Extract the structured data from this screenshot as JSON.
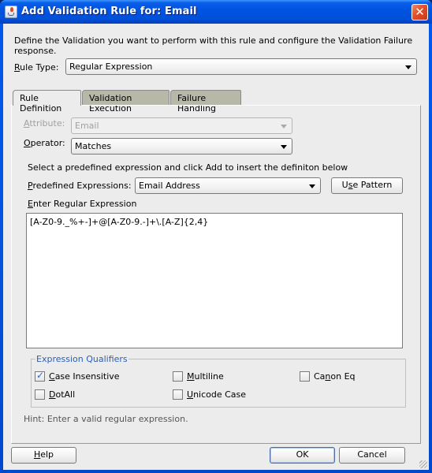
{
  "window": {
    "title": "Add Validation Rule for: Email",
    "app_icon": "java-cup-icon",
    "close_icon": "close-icon"
  },
  "intro": "Define the Validation you want to perform with this rule and configure the Validation Failure response.",
  "rule_type": {
    "label_mnemonic": "R",
    "label_rest": "ule Type:",
    "value": "Regular Expression"
  },
  "tabs": [
    {
      "label": "Rule Definition",
      "active": true
    },
    {
      "label": "Validation Execution",
      "active": false
    },
    {
      "label": "Failure Handling",
      "active": false
    }
  ],
  "attribute": {
    "label_mnemonic": "A",
    "label_rest": "ttribute:",
    "value": "Email",
    "disabled": true
  },
  "operator": {
    "label_mnemonic": "O",
    "label_rest": "perator:",
    "value": "Matches"
  },
  "predefined_hint": "Select a predefined expression and click Add to insert the definiton below",
  "predefined": {
    "label_mnemonic": "P",
    "label_rest": "redefined Expressions:",
    "value": "Email Address",
    "button_pre": "U",
    "button_mnemonic": "s",
    "button_rest": "e Pattern"
  },
  "regex": {
    "label_mnemonic": "E",
    "label_rest": "nter Regular Expression",
    "value": "[A-Z0-9._%+-]+@[A-Z0-9.-]+\\.[A-Z]{2,4}"
  },
  "qualifiers": {
    "legend": "Expression Qualifiers",
    "items": [
      {
        "pre": "",
        "mnemonic": "C",
        "rest": "ase Insensitive",
        "checked": true
      },
      {
        "pre": "",
        "mnemonic": "M",
        "rest": "ultiline",
        "checked": false
      },
      {
        "pre": "Ca",
        "mnemonic": "n",
        "rest": "on Eq",
        "checked": false
      },
      {
        "pre": "",
        "mnemonic": "D",
        "rest": "otAll",
        "checked": false
      },
      {
        "pre": "",
        "mnemonic": "U",
        "rest": "nicode Case",
        "checked": false
      }
    ]
  },
  "hint": "Hint: Enter a valid regular expression.",
  "buttons": {
    "help_mnemonic": "H",
    "help_rest": "elp",
    "ok": "OK",
    "cancel": "Cancel"
  }
}
